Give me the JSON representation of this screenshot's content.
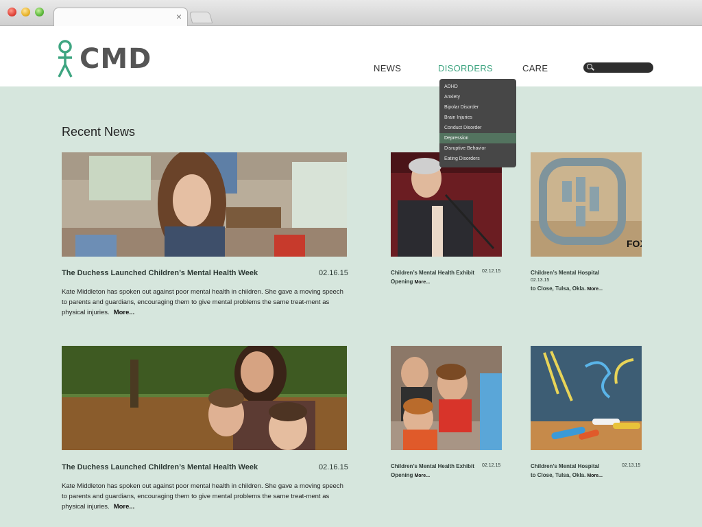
{
  "browser": {
    "tab_close": "×"
  },
  "header": {
    "logo_text": "CMD",
    "nav": {
      "news": "NEWS",
      "disorders": "DISORDERS",
      "care": "CARE"
    },
    "search_placeholder": ""
  },
  "dropdown": {
    "items": [
      "ADHD",
      "Anxiety",
      "Bipolar Disorder",
      "Brain Injuries",
      "Conduct Disorder",
      "Depression",
      "Disruptive Behavior",
      "Eating Disorders"
    ],
    "active": "Depression"
  },
  "main": {
    "section_title": "Recent News",
    "featured": [
      {
        "title": "The Duchess Launched Children’s Mental Health Week",
        "date": "02.16.15",
        "body": "Kate Middleton has spoken out against poor mental health in children. She gave a moving speech to parents and guardians, encouraging them to give mental problems the same treat-ment as physical injuries.",
        "more": "More..."
      },
      {
        "title": "The Duchess Launched Children’s Mental Health Week",
        "date": "02.16.15",
        "body": "Kate Middleton has spoken out against poor mental health in children. She gave a moving speech to parents and guardians, encouraging them to give mental problems the same treat-ment as physical injuries.",
        "more": "More..."
      }
    ],
    "small": [
      {
        "title": "Children’s Mental Health Exhibit Opening",
        "date": "02.12.15",
        "more": "More..."
      },
      {
        "title_line1": "Children’s Mental Hospital",
        "title_line2": "to Close, Tulsa, Okla.",
        "date": "02.13.15",
        "more": "More..."
      },
      {
        "title": "Children’s Mental Health Exhibit Opening",
        "date": "02.12.15",
        "more": "More..."
      },
      {
        "title_line1": "Children’s Mental Hospital",
        "title_line2": "to Close, Tulsa, Okla.",
        "date": "02.13.15",
        "more": "More..."
      }
    ],
    "fox_logo": "FOX"
  },
  "colors": {
    "background": "#d6e6dd",
    "accent": "#3ea581",
    "dropdown_bg": "#474747",
    "dropdown_active": "#53735f"
  },
  "icons": [
    "search-icon",
    "close-icon",
    "logo-figure-icon"
  ]
}
